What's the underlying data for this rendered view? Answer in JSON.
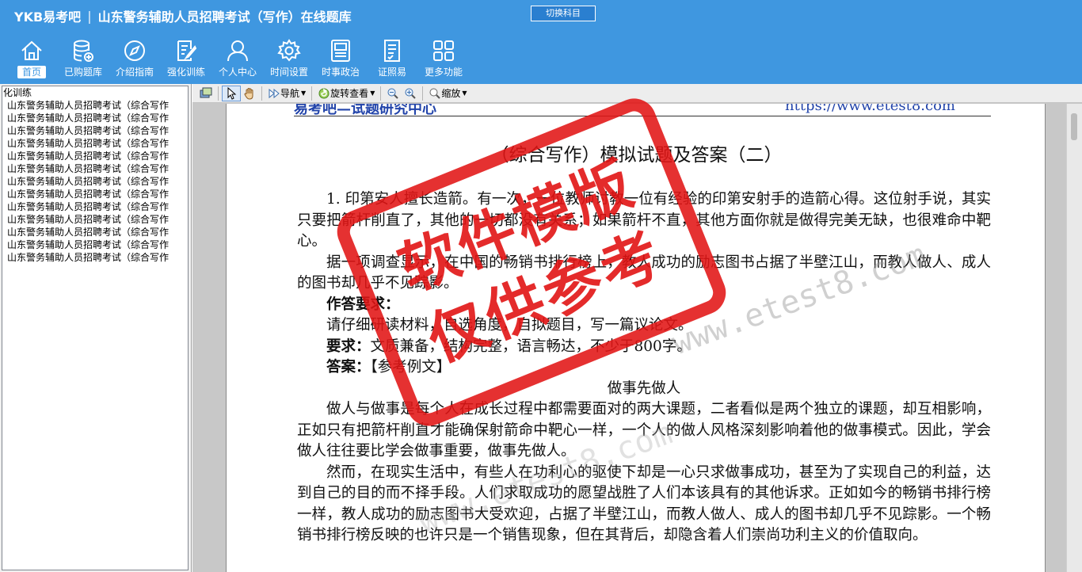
{
  "header": {
    "brand": "YKB易考吧",
    "separator": "|",
    "title": "山东警务辅助人员招聘考试（写作）在线题库",
    "switch_button": "切换科目"
  },
  "nav": [
    {
      "label": "首页",
      "icon": "home-icon",
      "active": true
    },
    {
      "label": "已购题库",
      "icon": "database-icon"
    },
    {
      "label": "介绍指南",
      "icon": "compass-icon"
    },
    {
      "label": "强化训练",
      "icon": "edit-icon"
    },
    {
      "label": "个人中心",
      "icon": "user-icon"
    },
    {
      "label": "时间设置",
      "icon": "gear-icon"
    },
    {
      "label": "时事政治",
      "icon": "newspaper-icon"
    },
    {
      "label": "证照易",
      "icon": "checklist-icon"
    },
    {
      "label": "更多功能",
      "icon": "grid-icon"
    }
  ],
  "sidebar": {
    "root": "化训练",
    "items": [
      "山东警务辅助人员招聘考试（综合写作",
      "山东警务辅助人员招聘考试（综合写作",
      "山东警务辅助人员招聘考试（综合写作",
      "山东警务辅助人员招聘考试（综合写作",
      "山东警务辅助人员招聘考试（综合写作",
      "山东警务辅助人员招聘考试（综合写作",
      "山东警务辅助人员招聘考试（综合写作",
      "山东警务辅助人员招聘考试（综合写作",
      "山东警务辅助人员招聘考试（综合写作",
      "山东警务辅助人员招聘考试（综合写作",
      "山东警务辅助人员招聘考试（综合写作",
      "山东警务辅助人员招聘考试（综合写作",
      "山东警务辅助人员招聘考试（综合写作"
    ]
  },
  "toolbar": {
    "nav_label": "导航",
    "rotate_label": "旋转查看",
    "zoom_label": "缩放"
  },
  "document": {
    "header_left": "易考吧—试题研究中心",
    "header_right": "https://www.etest8.com",
    "title": "（综合写作）模拟试题及答案（二）",
    "p1": "1. 印第安人擅长造箭。有一次，一位教师讨教一位有经验的印第安射手的造箭心得。这位射手说，其实只要把箭杆削直了，其他的一切都没有关系；如果箭杆不直，其他方面你就是做得完美无缺，也很难命中靶心。",
    "p2": "据一项调查显示，在中国的畅销书排行榜上，教人成功的励志图书占据了半壁江山，而教人做人、成人的图书却几乎不见踪影。",
    "req_label": "作答要求：",
    "req_text": "请仔细研读材料，自选角度，自拟题目，写一篇议论文。",
    "req2_label": "要求：",
    "req2_text": "文质兼备，结构完整，语言畅达，不少于800字。",
    "ans_label": "答案：",
    "ans_text": "【参考例文】",
    "essay_title": "做事先做人",
    "e1": "做人与做事是每个人在成长过程中都需要面对的两大课题，二者看似是两个独立的课题，却互相影响，正如只有把箭杆削直才能确保射箭命中靶心一样，一个人的做人风格深刻影响着他的做事模式。因此，学会做人往往要比学会做事重要，做事先做人。",
    "e2": "然而，在现实生活中，有些人在功利心的驱使下却是一心只求做事成功，甚至为了实现自己的利益，达到自己的目的而不择手段。人们求取成功的愿望战胜了人们本该具有的其他诉求。正如如今的畅销书排行榜一样，教人成功的励志图书大受欢迎，占据了半壁江山，而教人做人、成人的图书却几乎不见踪影。一个畅销书排行榜反映的也许只是一个销售现象，但在其背后，却隐含着人们崇尚功利主义的价值取向。"
  },
  "watermark": {
    "url": "www.etest8.com",
    "stamp_line1": "软件模版",
    "stamp_line2": "仅供参考"
  }
}
